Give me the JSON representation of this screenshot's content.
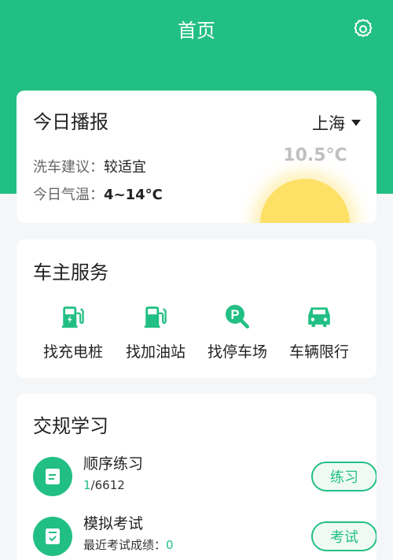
{
  "header": {
    "title": "首页",
    "settings_icon": "gear-icon"
  },
  "broadcast": {
    "title": "今日播报",
    "city": "上海",
    "wash_label": "洗车建议：",
    "wash_value": "较适宜",
    "temp_label": "今日气温：",
    "temp_value": "4~14°C",
    "current_temp": "10.5°C"
  },
  "services": {
    "title": "车主服务",
    "items": [
      {
        "label": "找充电桩",
        "icon": "charging-station-icon"
      },
      {
        "label": "找加油站",
        "icon": "gas-station-icon"
      },
      {
        "label": "找停车场",
        "icon": "parking-search-icon"
      },
      {
        "label": "车辆限行",
        "icon": "car-icon"
      }
    ]
  },
  "study": {
    "title": "交规学习",
    "items": [
      {
        "name": "顺序练习",
        "progress_current": "1",
        "progress_total": "/6612",
        "button": "练习",
        "icon": "document-icon"
      },
      {
        "name": "模拟考试",
        "sub_label": "最近考试成绩：",
        "sub_value": "0",
        "button": "考试",
        "icon": "exam-check-icon"
      }
    ]
  },
  "colors": {
    "accent": "#22bf84",
    "background": "#f5f6f8",
    "sun": "#fde066"
  }
}
